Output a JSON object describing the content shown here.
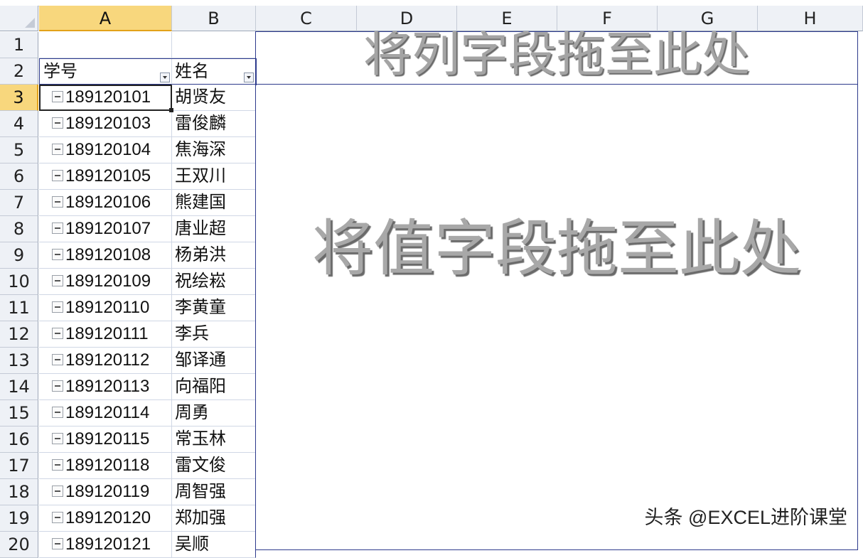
{
  "columns": [
    "A",
    "B",
    "C",
    "D",
    "E",
    "F",
    "G",
    "H"
  ],
  "active_column": "A",
  "rows": [
    "1",
    "2",
    "3",
    "4",
    "5",
    "6",
    "7",
    "8",
    "9",
    "10",
    "11",
    "12",
    "13",
    "14",
    "15",
    "16",
    "17",
    "18",
    "19",
    "20"
  ],
  "active_row": "3",
  "pivot": {
    "header_id": "学号",
    "header_name": "姓名",
    "drop_columns_label": "将列字段拖至此处",
    "drop_values_label": "将值字段拖至此处",
    "records": [
      {
        "id": "189120101",
        "name": "胡贤友"
      },
      {
        "id": "189120103",
        "name": "雷俊麟"
      },
      {
        "id": "189120104",
        "name": "焦海深"
      },
      {
        "id": "189120105",
        "name": "王双川"
      },
      {
        "id": "189120106",
        "name": "熊建国"
      },
      {
        "id": "189120107",
        "name": "唐业超"
      },
      {
        "id": "189120108",
        "name": "杨弟洪"
      },
      {
        "id": "189120109",
        "name": "祝绘崧"
      },
      {
        "id": "189120110",
        "name": "李黄童"
      },
      {
        "id": "189120111",
        "name": "李兵"
      },
      {
        "id": "189120112",
        "name": "邹译通"
      },
      {
        "id": "189120113",
        "name": "向福阳"
      },
      {
        "id": "189120114",
        "name": "周勇"
      },
      {
        "id": "189120115",
        "name": "常玉林"
      },
      {
        "id": "189120118",
        "name": "雷文俊"
      },
      {
        "id": "189120119",
        "name": "周智强"
      },
      {
        "id": "189120120",
        "name": "郑加强"
      },
      {
        "id": "189120121",
        "name": "吴顺"
      }
    ]
  },
  "watermark": "头条 @EXCEL进阶课堂",
  "colors": {
    "accent": "#2d3a8c",
    "header_bg": "#eef1f6",
    "active_header": "#f8d77d"
  }
}
